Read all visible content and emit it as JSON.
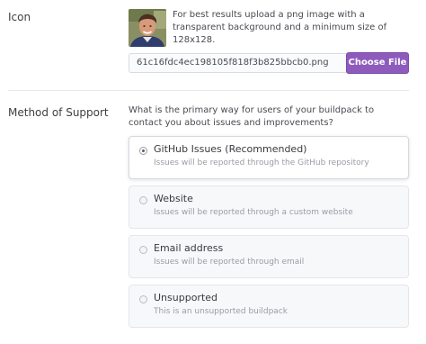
{
  "icon_section": {
    "label": "Icon",
    "help_text": "For best results upload a png image with a transparent background and a minimum size of 128x128.",
    "file_name": "61c16fdc4ec198105f818f3b825bbcb0.png",
    "choose_file_label": "Choose File",
    "accent_color": "#8e5bbd"
  },
  "support_section": {
    "label": "Method of Support",
    "question": "What is the primary way for users of your buildpack to contact you about issues and improvements?",
    "options": [
      {
        "title": "GitHub Issues (Recommended)",
        "description": "Issues will be reported through the GitHub repository",
        "selected": true
      },
      {
        "title": "Website",
        "description": "Issues will be reported through a custom website",
        "selected": false
      },
      {
        "title": "Email address",
        "description": "Issues will be reported through email",
        "selected": false
      },
      {
        "title": "Unsupported",
        "description": "This is an unsupported buildpack",
        "selected": false
      }
    ]
  }
}
